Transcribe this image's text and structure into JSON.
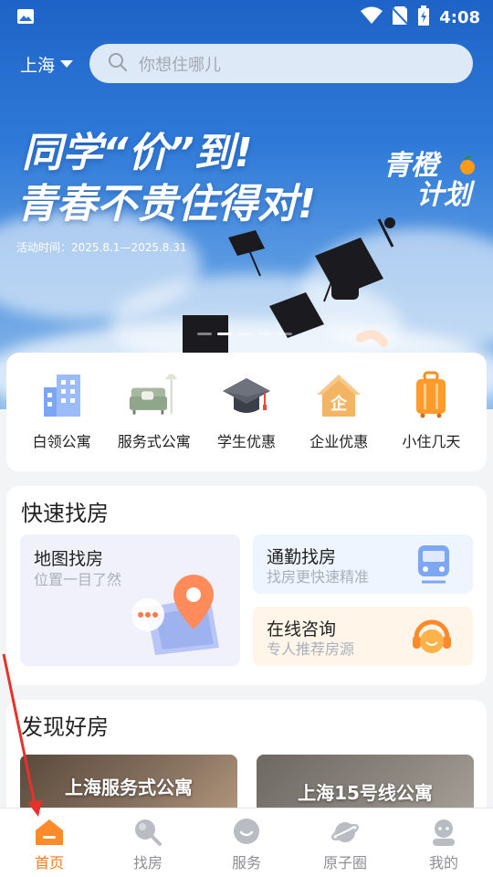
{
  "status_bar": {
    "time": "4:08"
  },
  "header": {
    "city": "上海",
    "search_placeholder": "你想住哪儿"
  },
  "banner": {
    "headline_line1": "同学“价”到!",
    "headline_line2": "青春不贵住得对!",
    "activity_time": "活动时间：2025.8.1—2025.8.31",
    "brand_line1": "青橙",
    "brand_line2": "计划",
    "active_dot": 1
  },
  "categories": [
    {
      "label": "白领公寓",
      "icon": "office-building-icon"
    },
    {
      "label": "服务式公寓",
      "icon": "sofa-icon"
    },
    {
      "label": "学生优惠",
      "icon": "graduation-cap-icon"
    },
    {
      "label": "企业优惠",
      "icon": "enterprise-house-icon"
    },
    {
      "label": "小住几天",
      "icon": "suitcase-icon"
    }
  ],
  "quick_find": {
    "title": "快速找房",
    "map": {
      "title": "地图找房",
      "subtitle": "位置一目了然"
    },
    "commute": {
      "title": "通勤找房",
      "subtitle": "找房更快速精准"
    },
    "consult": {
      "title": "在线咨询",
      "subtitle": "专人推荐房源"
    }
  },
  "discover": {
    "title": "发现好房",
    "cards": [
      {
        "name": "上海服务式公寓"
      },
      {
        "name": "上海15号线公寓"
      }
    ]
  },
  "bottom_nav": [
    {
      "label": "首页",
      "icon": "home-icon",
      "active": true
    },
    {
      "label": "找房",
      "icon": "search-icon",
      "active": false
    },
    {
      "label": "服务",
      "icon": "chat-service-icon",
      "active": false
    },
    {
      "label": "原子圈",
      "icon": "planet-icon",
      "active": false
    },
    {
      "label": "我的",
      "icon": "user-icon",
      "active": false
    }
  ],
  "colors": {
    "accent": "#ff7a1a",
    "banner_top": "#1e63c7",
    "nav_inactive": "#8e8e93"
  }
}
